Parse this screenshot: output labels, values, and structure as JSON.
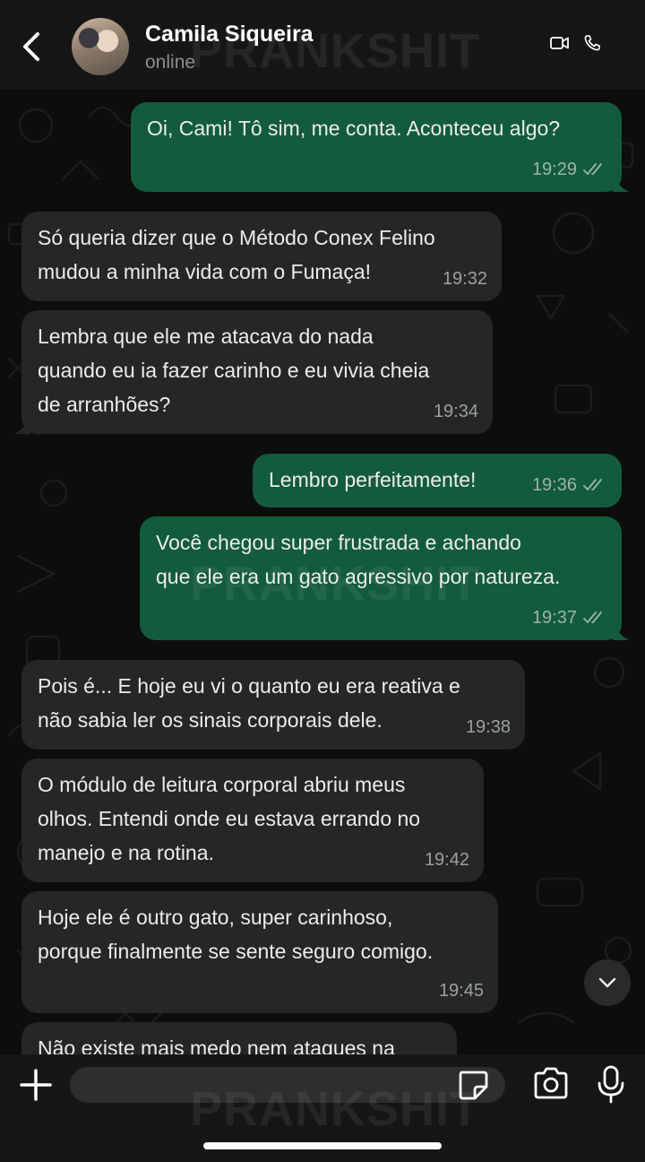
{
  "header": {
    "contact_name": "Camila Siqueira",
    "status": "online",
    "icons": [
      "back-chevron-icon",
      "video-call-icon",
      "voice-call-icon"
    ]
  },
  "watermark": "PRANKSHIT",
  "messages": [
    {
      "direction": "out",
      "text": "Oi, Cami! Tô sim, me conta. Aconteceu algo?",
      "time": "19:29",
      "status": "read"
    },
    {
      "direction": "in",
      "text": "Só queria dizer que o Método Conex Felino\nmudou a minha vida com o Fumaça!",
      "time": "19:32"
    },
    {
      "direction": "in",
      "text": "Lembra que ele me atacava do nada\nquando eu ia fazer carinho e eu vivia cheia\nde arranhões?",
      "time": "19:34"
    },
    {
      "direction": "out",
      "text": "Lembro perfeitamente!",
      "time": "19:36",
      "status": "read"
    },
    {
      "direction": "out",
      "text": "Você chegou super frustrada e achando\nque ele era um gato agressivo por natureza.",
      "time": "19:37",
      "status": "read"
    },
    {
      "direction": "in",
      "text": "Pois é... E hoje eu vi o quanto eu era reativa e\nnão sabia ler os sinais corporais dele.",
      "time": "19:38"
    },
    {
      "direction": "in",
      "text": "O módulo de leitura corporal abriu meus\nolhos. Entendi onde eu estava errando no\nmanejo e na rotina.",
      "time": "19:42"
    },
    {
      "direction": "in",
      "text": "Hoje ele é outro gato, super carinhoso,\nporque finalmente se sente seguro comigo.",
      "time": "19:45"
    },
    {
      "direction": "in",
      "text": "Não existe mais medo nem ataques na",
      "time": ""
    }
  ],
  "input": {
    "placeholder": "",
    "icons": [
      "plus-icon",
      "sticker-icon",
      "camera-icon",
      "microphone-icon"
    ]
  },
  "colors": {
    "incoming_bubble": "#262626",
    "outgoing_bubble": "#135b3d",
    "header_bg": "#161616",
    "chat_bg": "#0d0d0d"
  }
}
